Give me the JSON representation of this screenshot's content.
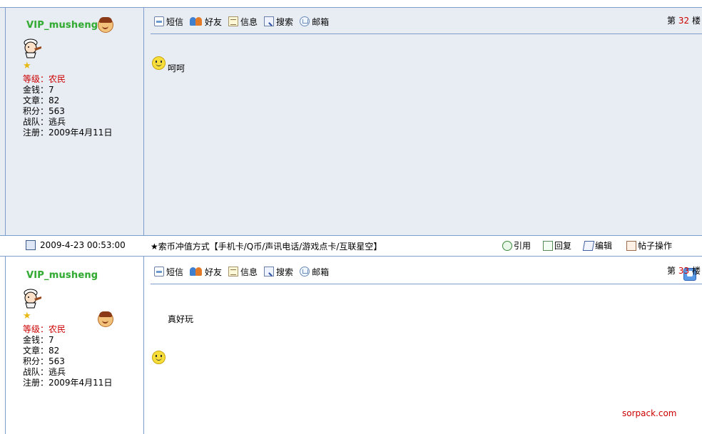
{
  "toolbar": {
    "sms": "短信",
    "friend": "好友",
    "info": "信息",
    "search": "搜索",
    "mailbox": "邮箱"
  },
  "floor_prefix": "第",
  "floor_suffix": "楼",
  "posts": [
    {
      "username": "VIP_musheng",
      "level": "等级：农民",
      "money": "金钱：7",
      "articles": "文章：82",
      "points": "积分：563",
      "team": "战队：逃兵",
      "registered": "注册：2009年4月11日",
      "floor": "32",
      "content": "呵呵"
    },
    {
      "username": "VIP_musheng",
      "level": "等级：农民",
      "money": "金钱：7",
      "articles": "文章：82",
      "points": "积分：563",
      "team": "战队：逃兵",
      "registered": "注册：2009年4月11日",
      "floor": "33",
      "content": "真好玩"
    }
  ],
  "separator": {
    "timestamp": "2009-4-23 00:53:00",
    "banner": "★索币冲值方式【手机卡/Q币/声讯电话/游戏点卡/互联星空】",
    "quote": "引用",
    "reply": "回复",
    "edit": "编辑",
    "post_ops": "帖子操作"
  },
  "watermark": "sorpack.com"
}
